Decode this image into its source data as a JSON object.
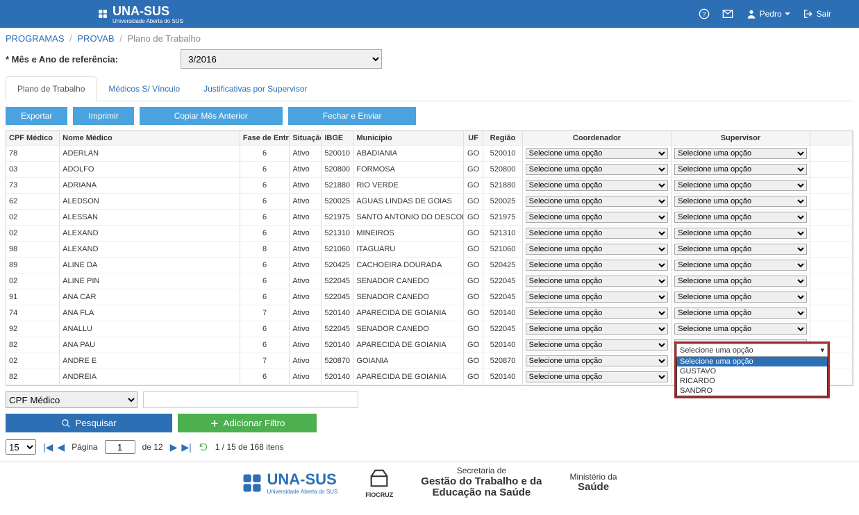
{
  "navbar": {
    "brand": "UNA-SUS",
    "brand_sub": "Universidade Aberta do SUS",
    "user": "Pedro",
    "logout": "Sair"
  },
  "breadcrumb": {
    "items": [
      "PROGRAMAS",
      "PROVAB"
    ],
    "current": "Plano de Trabalho"
  },
  "reference": {
    "label": "* Mês e Ano de referência:",
    "value": "3/2016"
  },
  "tabs": {
    "items": [
      "Plano de Trabalho",
      "Médicos S/ Vínculo",
      "Justificativas por Supervisor"
    ],
    "active": 0
  },
  "actions": {
    "export": "Exportar",
    "print": "Imprimir",
    "copy_prev": "Copiar Mês Anterior",
    "close_send": "Fechar e Enviar"
  },
  "table": {
    "headers": {
      "cpf": "CPF Médico",
      "nome": "Nome Médico",
      "fase": "Fase de Entrada",
      "sit": "Situação",
      "ibge": "IBGE",
      "mun": "Município",
      "uf": "UF",
      "reg": "Região",
      "coord": "Coordenador",
      "sup": "Supervisor"
    },
    "select_placeholder": "Selecione uma opção",
    "rows": [
      {
        "cpf": "78",
        "nome": "ADERLAN",
        "fase": "6",
        "sit": "Ativo",
        "ibge": "520010",
        "mun": "ABADIANIA",
        "uf": "GO",
        "reg": "520010"
      },
      {
        "cpf": "03",
        "nome": "ADOLFO",
        "fase": "6",
        "sit": "Ativo",
        "ibge": "520800",
        "mun": "FORMOSA",
        "uf": "GO",
        "reg": "520800"
      },
      {
        "cpf": "73",
        "nome": "ADRIANA",
        "fase": "6",
        "sit": "Ativo",
        "ibge": "521880",
        "mun": "RIO VERDE",
        "uf": "GO",
        "reg": "521880"
      },
      {
        "cpf": "62",
        "nome": "ALEDSON",
        "fase": "6",
        "sit": "Ativo",
        "ibge": "520025",
        "mun": "AGUAS LINDAS DE GOIAS",
        "uf": "GO",
        "reg": "520025"
      },
      {
        "cpf": "02",
        "nome": "ALESSAN",
        "fase": "6",
        "sit": "Ativo",
        "ibge": "521975",
        "mun": "SANTO ANTONIO DO DESCOBERT",
        "uf": "GO",
        "reg": "521975"
      },
      {
        "cpf": "02",
        "nome": "ALEXAND",
        "fase": "6",
        "sit": "Ativo",
        "ibge": "521310",
        "mun": "MINEIROS",
        "uf": "GO",
        "reg": "521310"
      },
      {
        "cpf": "98",
        "nome": "ALEXAND",
        "fase": "8",
        "sit": "Ativo",
        "ibge": "521060",
        "mun": "ITAGUARU",
        "uf": "GO",
        "reg": "521060"
      },
      {
        "cpf": "89",
        "nome": "ALINE DA",
        "fase": "6",
        "sit": "Ativo",
        "ibge": "520425",
        "mun": "CACHOEIRA DOURADA",
        "uf": "GO",
        "reg": "520425"
      },
      {
        "cpf": "02",
        "nome": "ALINE PIN",
        "fase": "6",
        "sit": "Ativo",
        "ibge": "522045",
        "mun": "SENADOR CANEDO",
        "uf": "GO",
        "reg": "522045"
      },
      {
        "cpf": "91",
        "nome": "ANA CAR",
        "fase": "6",
        "sit": "Ativo",
        "ibge": "522045",
        "mun": "SENADOR CANEDO",
        "uf": "GO",
        "reg": "522045"
      },
      {
        "cpf": "74",
        "nome": "ANA FLA",
        "fase": "7",
        "sit": "Ativo",
        "ibge": "520140",
        "mun": "APARECIDA DE GOIANIA",
        "uf": "GO",
        "reg": "520140"
      },
      {
        "cpf": "92",
        "nome": "ANALLU",
        "fase": "6",
        "sit": "Ativo",
        "ibge": "522045",
        "mun": "SENADOR CANEDO",
        "uf": "GO",
        "reg": "522045"
      },
      {
        "cpf": "82",
        "nome": "ANA PAU",
        "fase": "6",
        "sit": "Ativo",
        "ibge": "520140",
        "mun": "APARECIDA DE GOIANIA",
        "uf": "GO",
        "reg": "520140"
      },
      {
        "cpf": "02",
        "nome": "ANDRE E",
        "fase": "7",
        "sit": "Ativo",
        "ibge": "520870",
        "mun": "GOIANIA",
        "uf": "GO",
        "reg": "520870"
      },
      {
        "cpf": "82",
        "nome": "ANDREIA",
        "fase": "6",
        "sit": "Ativo",
        "ibge": "520140",
        "mun": "APARECIDA DE GOIANIA",
        "uf": "GO",
        "reg": "520140"
      }
    ],
    "supervisor_options": [
      "Selecione uma opção",
      "GUSTAVO",
      "RICARDO",
      "SANDRO"
    ]
  },
  "filter": {
    "field_value": "CPF Médico",
    "input_value": "",
    "search": "Pesquisar",
    "add": "Adicionar Filtro"
  },
  "paginator": {
    "page_size": "15",
    "page_label_pre": "Página",
    "page": "1",
    "page_label_post": "de 12",
    "summary": "1 / 15 de 168 itens"
  },
  "footer": {
    "unasus": "UNA-SUS",
    "unasus_sub": "Universidade Aberta do SUS",
    "fiocruz": "FIOCRUZ",
    "sgt1": "Secretaria de",
    "sgt2": "Gestão do Trabalho e da",
    "sgt3": "Educação na Saúde",
    "ms1": "Ministério da",
    "ms2": "Saúde"
  }
}
